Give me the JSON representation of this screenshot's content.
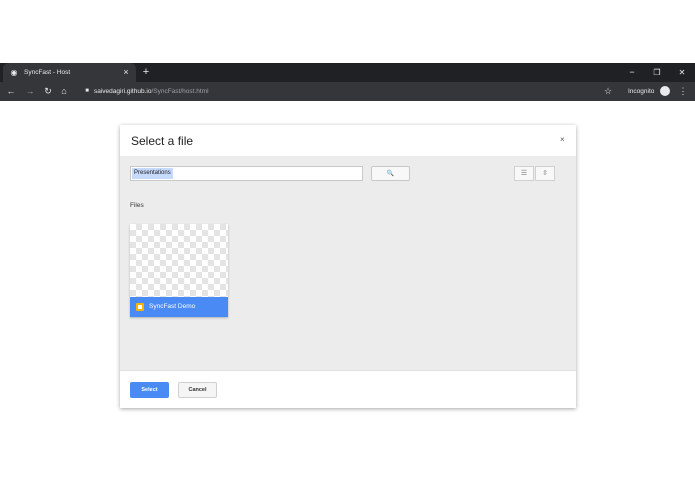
{
  "browser": {
    "tab_title": "SyncFast - Host",
    "tab_close": "×",
    "new_tab": "+",
    "url_domain": "saivedagiri.github.io",
    "url_path": "/SyncFast/host.html",
    "profile_label": "Incognito",
    "icons": {
      "back": "back-arrow-icon",
      "forward": "forward-arrow-icon",
      "reload": "reload-icon",
      "home": "home-icon",
      "lock": "lock-icon",
      "star": "star-icon",
      "menu": "menu-icon"
    },
    "window_controls": {
      "minimize": "−",
      "restore": "❐",
      "close": "✕"
    }
  },
  "dialog": {
    "title": "Select a file",
    "close_label": "×",
    "search": {
      "token": "Presentations",
      "button_icon": "🔍"
    },
    "view_buttons": {
      "list": "☰",
      "sort": "⇳"
    },
    "section_label": "Files",
    "files": [
      {
        "name": "SyncFast Demo",
        "icon": "google-slides-icon",
        "icon_color": "#f4b400"
      }
    ],
    "select_label": "Select",
    "cancel_label": "Cancel"
  },
  "colors": {
    "accent": "#4a8af4",
    "chrome_dark": "#202124",
    "chrome_toolbar": "#35363a"
  }
}
